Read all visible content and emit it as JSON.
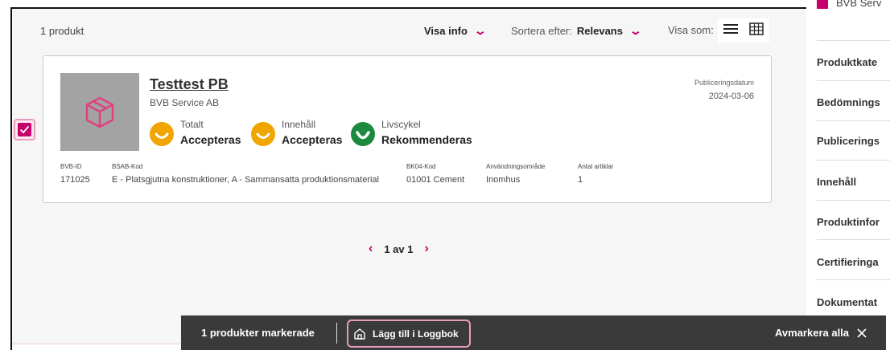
{
  "toolbar": {
    "count": "1 produkt",
    "visa_info": "Visa info",
    "sort_label": "Sortera efter:",
    "sort_value": "Relevans",
    "visa_som": "Visa som:"
  },
  "product": {
    "title": "Testtest PB",
    "company": "BVB Service AB",
    "selected": true,
    "ratings": [
      {
        "label": "Totalt",
        "value": "Accepteras",
        "color": "#f0a500"
      },
      {
        "label": "Innehåll",
        "value": "Accepteras",
        "color": "#f0a500"
      },
      {
        "label": "Livscykel",
        "value": "Rekommenderas",
        "color": "#1b8a3e"
      }
    ],
    "pub_label": "Publiceringsdatum",
    "pub_date": "2024-03-06",
    "meta": [
      {
        "label": "BVB-ID",
        "value": "171025"
      },
      {
        "label": "BSAB-Kod",
        "value": "E - Platsgjutna konstruktioner, A - Sammansatta produktionsmaterial"
      },
      {
        "label": "BK04-Kod",
        "value": "01001 Cement"
      },
      {
        "label": "Användningsområde",
        "value": "Inomhus"
      },
      {
        "label": "Antal artiklar",
        "value": "1"
      }
    ]
  },
  "pagination": {
    "text": "1 av 1"
  },
  "sidebar": {
    "top_text": "BVB Serv",
    "items": [
      "Produktkate",
      "Bedömnings",
      "Publicerings",
      "Innehåll",
      "Produktinfor",
      "Certifieringa",
      "Dokumentat"
    ]
  },
  "actionbar": {
    "count_text": "1 produkter markerade",
    "add_label": "Lägg till i Loggbok",
    "clear_label": "Avmarkera alla"
  },
  "colors": {
    "accent": "#c8006c",
    "accent_light": "#e89bbf"
  }
}
